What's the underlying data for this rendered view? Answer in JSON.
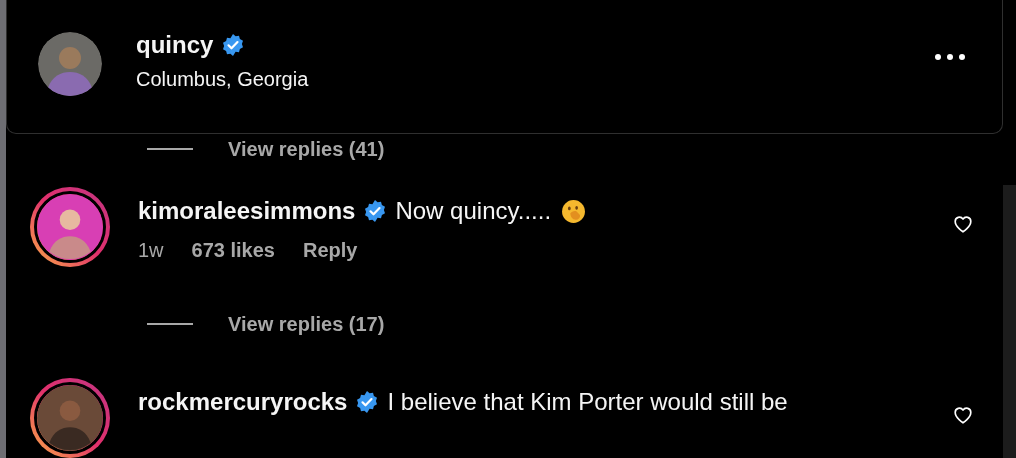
{
  "post_header": {
    "username": "quincy",
    "verified": true,
    "location": "Columbus, Georgia"
  },
  "feed": [
    {
      "kind": "replies",
      "label": "View replies (41)"
    },
    {
      "kind": "comment",
      "username": "kimoraleesimmons",
      "verified": true,
      "text": "Now quincy.....",
      "emoji": true,
      "time": "1w",
      "likes": "673 likes",
      "reply": "Reply",
      "liked": false
    },
    {
      "kind": "replies",
      "label": "View replies (17)"
    },
    {
      "kind": "comment",
      "username": "rockmercuryrocks",
      "verified": true,
      "text": "I believe that Kim Porter would still be",
      "emoji": false,
      "liked": false
    }
  ]
}
